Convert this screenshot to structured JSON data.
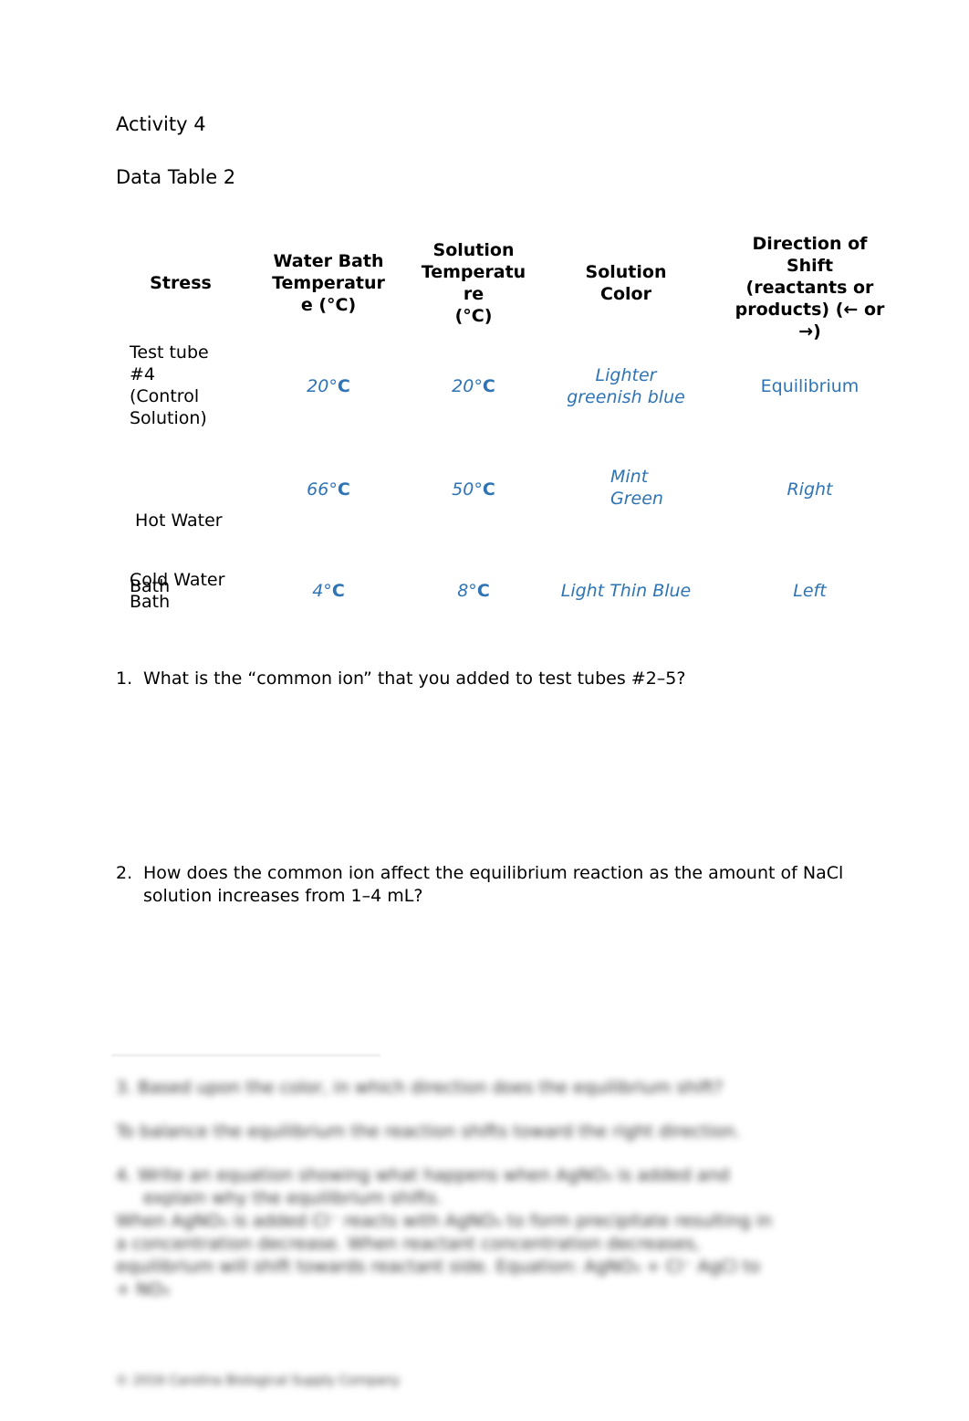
{
  "document": {
    "activity_title": "Activity 4",
    "table_title": "Data Table 2"
  },
  "table": {
    "headers": {
      "stress": "Stress",
      "water_bath_temp": "Water Bath Temperature (°C)",
      "solution_temp": "Solution Temperature (°C)",
      "solution_color": "Solution Color",
      "direction": "Direction of Shift (reactants or products) (← or →)"
    },
    "header_lines": {
      "water_bath_temp": [
        "Water Bath",
        "Temperatur",
        "e (°C)"
      ],
      "solution_temp": [
        "Solution",
        "Temperatu",
        "re",
        "(°C)"
      ],
      "solution_color": [
        "Solution",
        "Color"
      ],
      "direction": [
        "Direction of",
        "Shift",
        "(reactants or",
        "products) (← or",
        "→)"
      ]
    },
    "rows": [
      {
        "stress_lines": [
          "Test tube",
          "#4",
          "(Control",
          "Solution)"
        ],
        "water_bath_temp_num": "20°",
        "water_bath_temp_unit": "C",
        "solution_temp_num": "20°",
        "solution_temp_unit": "C",
        "color_lines": [
          "Lighter",
          "greenish blue"
        ],
        "direction": "Equilibrium"
      },
      {
        "stress_lines": [
          " Hot Water",
          "Bath"
        ],
        "water_bath_temp_num": "66°",
        "water_bath_temp_unit": "C",
        "solution_temp_num": "50°",
        "solution_temp_unit": "C",
        "color_lines": [
          "Mint",
          "Green"
        ],
        "direction": "Right"
      },
      {
        "stress_lines": [
          "Cold Water",
          "Bath"
        ],
        "water_bath_temp_num": "4°",
        "water_bath_temp_unit": "C",
        "solution_temp_num": "8°",
        "solution_temp_unit": "C",
        "color_lines": [
          "Light Thin Blue"
        ],
        "direction": "Left"
      }
    ],
    "value_color": "#2e74b5"
  },
  "questions": [
    {
      "number": "1.",
      "text": "What is the “common ion” that you added to test tubes #2–5?"
    },
    {
      "number": "2.",
      "text": "How does the common ion affect the equilibrium reaction as the amount of NaCl solution increases from 1–4 mL?"
    }
  ],
  "blurred": {
    "q3": "3.  Based upon the color, in which direction does the equilibrium shift?",
    "a3": "To balance the equilibrium the reaction shifts toward the right direction.",
    "q4_line1": "4.  Write an equation showing what happens when AgNO₃ is added and",
    "q4_line2": "explain why the equilibrium shifts.",
    "a4_lines": [
      "When AgNO₃ is added Cl⁻ reacts with AgNO₃ to form precipitate resulting in",
      "a concentration decrease. When reactant concentration decreases,",
      "equilibrium will shift towards reactant side.   Equation: AgNO₃ + Cl⁻ AgCl to",
      "+ NO₃"
    ],
    "footer": "© 2016 Carolina Biological Supply Company"
  }
}
